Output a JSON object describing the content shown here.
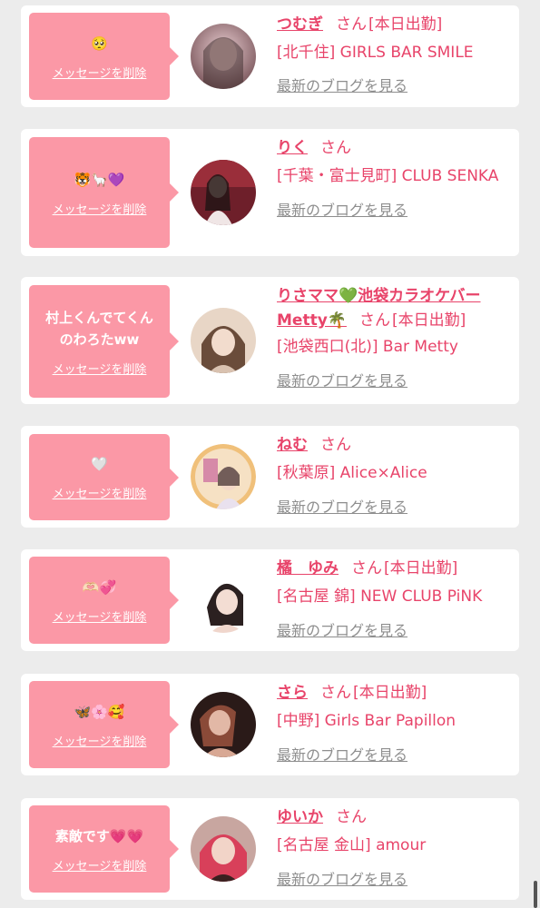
{
  "delete_label": "メッセージを削除",
  "blog_label": "最新のブログを見る",
  "san_label": "さん",
  "items": [
    {
      "message": "🥺",
      "name": "つむぎ",
      "badge": "[本日出勤]",
      "shop": "[北千住] GIRLS BAR SMILE",
      "avatar_colors": [
        "#c9a9b0",
        "#8a6a6f"
      ]
    },
    {
      "message": "🐯🦙💜",
      "name": "りく",
      "badge": "",
      "shop": "[千葉・富士見町] CLUB SENKA",
      "avatar_colors": [
        "#7a2430",
        "#2a1a1f"
      ]
    },
    {
      "message": "村上くんでてくん\nのわろたww",
      "name": "りさママ💚池袋カラオケバーMetty🌴",
      "badge": "[本日出勤]",
      "shop": "[池袋西口(北)] Bar Metty",
      "avatar_colors": [
        "#e9d4c4",
        "#9c7a5e"
      ]
    },
    {
      "message": "🤍",
      "name": "ねむ",
      "badge": "",
      "shop": "[秋葉原] Alice×Alice",
      "avatar_colors": [
        "#f4d9a8",
        "#d98aa2"
      ]
    },
    {
      "message": "🫶🏻💞",
      "name": "橘　ゆみ",
      "badge": "[本日出勤]",
      "shop": "[名古屋 錦] NEW CLUB PiNK",
      "avatar_colors": [
        "#f2ece8",
        "#3b2a28"
      ]
    },
    {
      "message": "🦋🌸🥰",
      "name": "さら",
      "badge": "[本日出勤]",
      "shop": "[中野] Girls Bar Papillon",
      "avatar_colors": [
        "#c98a78",
        "#3a2420"
      ]
    },
    {
      "message": "素敵です💗💗",
      "name": "ゆいか",
      "badge": "",
      "shop": "[名古屋 金山] amour",
      "avatar_colors": [
        "#e25a6a",
        "#6a2430"
      ]
    }
  ]
}
